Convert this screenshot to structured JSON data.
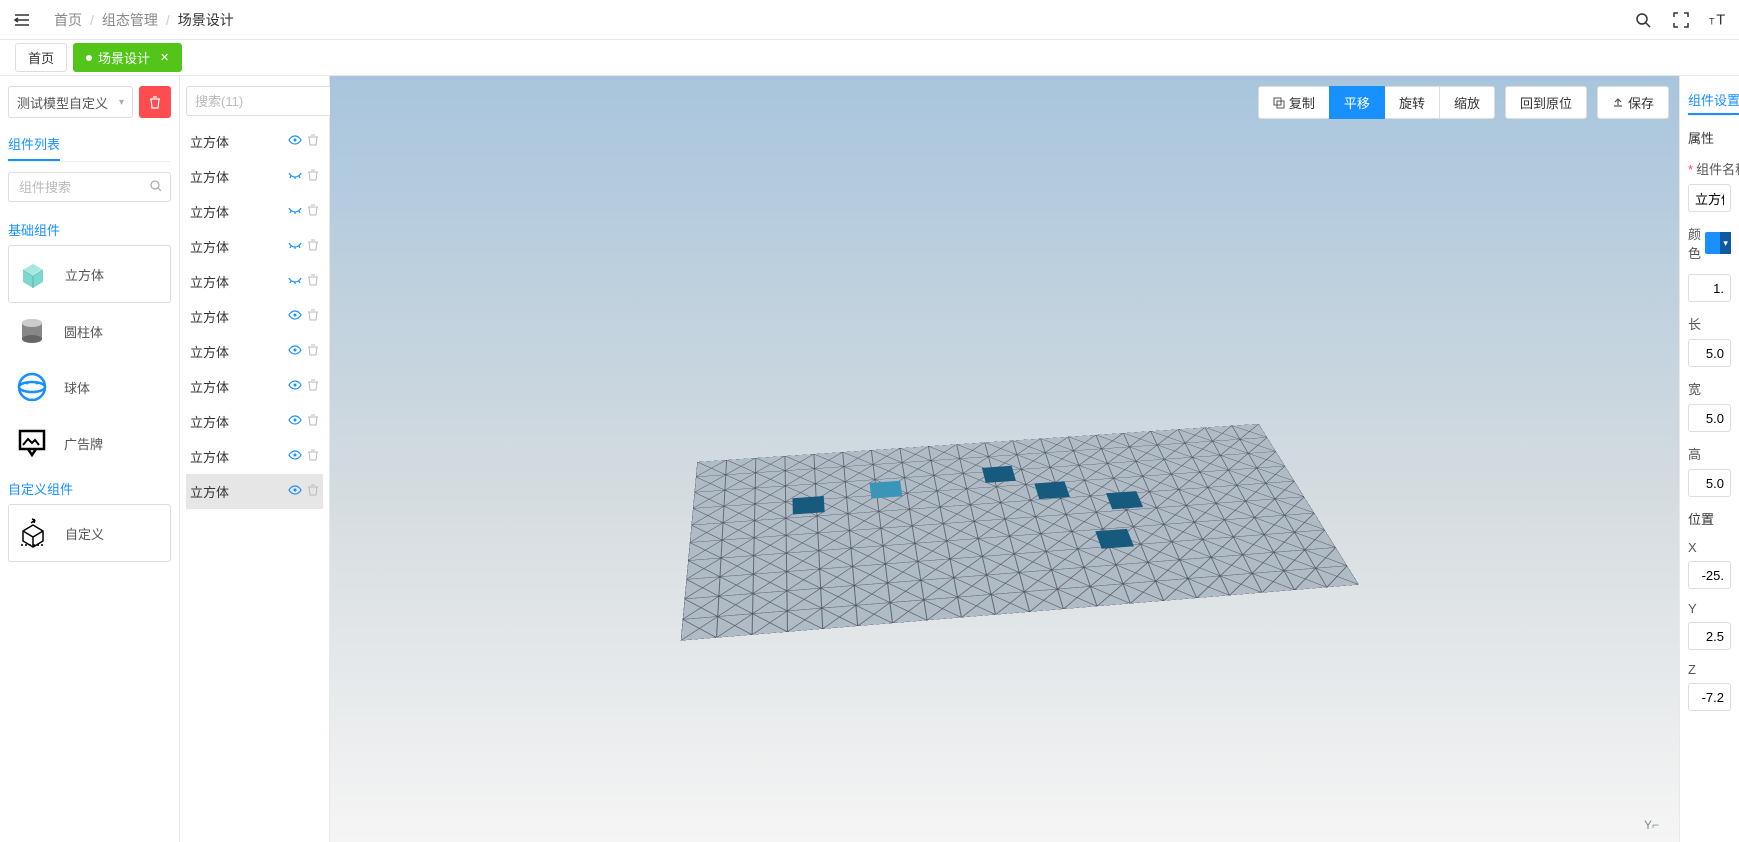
{
  "breadcrumb": {
    "home": "首页",
    "group": "组态管理",
    "scene": "场景设计"
  },
  "tabs": {
    "home": "首页",
    "scene": "场景设计"
  },
  "topbar_icons": {
    "search": "search",
    "fullscreen": "fullscreen",
    "fontsize": "TT"
  },
  "left": {
    "model_select": "测试模型自定义",
    "tab": "组件列表",
    "search_placeholder": "组件搜索",
    "section_basic": "基础组件",
    "section_custom": "自定义组件",
    "components": {
      "cube": "立方体",
      "cylinder": "圆柱体",
      "sphere": "球体",
      "billboard": "广告牌",
      "custom": "自定义"
    }
  },
  "outline": {
    "search_placeholder": "搜索(11)",
    "items": [
      {
        "label": "立方体",
        "visible": true,
        "selected": false
      },
      {
        "label": "立方体",
        "visible": false,
        "selected": false
      },
      {
        "label": "立方体",
        "visible": false,
        "selected": false
      },
      {
        "label": "立方体",
        "visible": false,
        "selected": false
      },
      {
        "label": "立方体",
        "visible": false,
        "selected": false
      },
      {
        "label": "立方体",
        "visible": true,
        "selected": false
      },
      {
        "label": "立方体",
        "visible": true,
        "selected": false
      },
      {
        "label": "立方体",
        "visible": true,
        "selected": false
      },
      {
        "label": "立方体",
        "visible": true,
        "selected": false
      },
      {
        "label": "立方体",
        "visible": true,
        "selected": false
      },
      {
        "label": "立方体",
        "visible": true,
        "selected": true
      }
    ]
  },
  "canvas": {
    "copy": "复制",
    "translate": "平移",
    "rotate": "旋转",
    "scale": "缩放",
    "reset": "回到原位",
    "save": "保存"
  },
  "right": {
    "tab": "组件设置",
    "section_attr": "属性",
    "name_label": "组件名称",
    "name_value": "立方体",
    "color_label": "颜色",
    "scale_value": "1.",
    "length_label": "长",
    "length_value": "5.0",
    "width_label": "宽",
    "width_value": "5.0",
    "height_label": "高",
    "height_value": "5.0",
    "position_label": "位置",
    "x_label": "X",
    "x_value": "-25.",
    "y_label": "Y",
    "y_value": "2.5",
    "z_label": "Z",
    "z_value": "-7.2"
  }
}
